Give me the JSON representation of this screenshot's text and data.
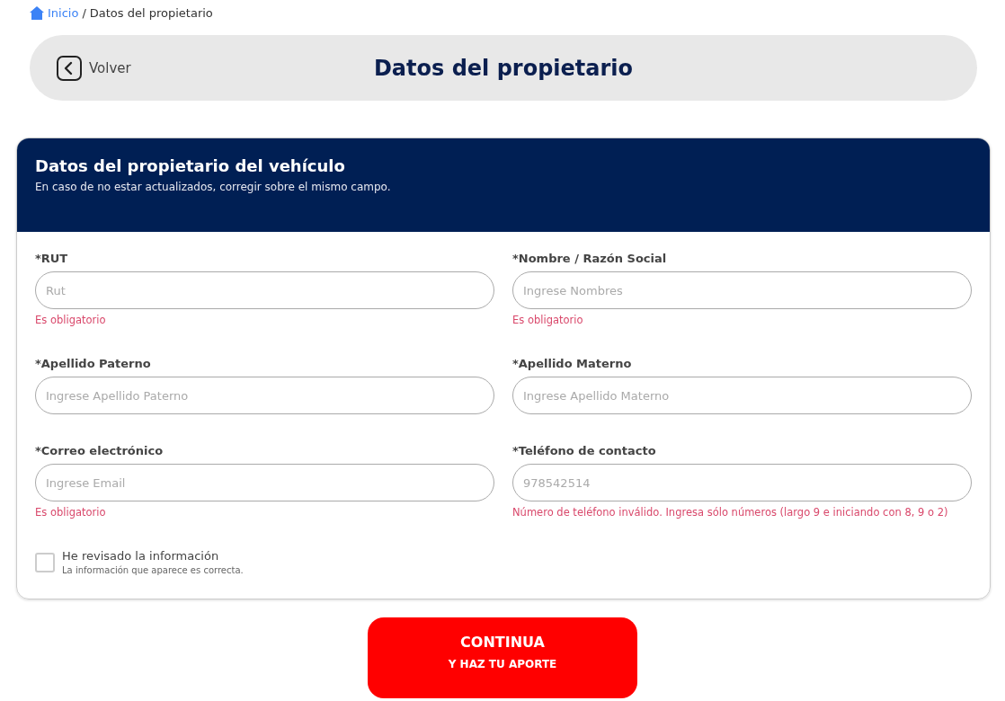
{
  "breadcrumb": {
    "home": "Inicio",
    "separator": "/",
    "current": "Datos del propietario"
  },
  "header": {
    "back": "Volver",
    "title": "Datos del propietario"
  },
  "card": {
    "title": "Datos del propietario del vehículo",
    "subtitle": "En caso de no estar actualizados, corregir sobre el mismo campo.",
    "fields": [
      {
        "label": "*RUT",
        "placeholder": "Rut",
        "error": "Es obligatorio"
      },
      {
        "label": "*Nombre / Razón Social",
        "placeholder": "Ingrese Nombres",
        "error": "Es obligatorio"
      },
      {
        "label": "*Apellido Paterno",
        "placeholder": "Ingrese Apellido Paterno"
      },
      {
        "label": "*Apellido Materno",
        "placeholder": "Ingrese Apellido Materno"
      },
      {
        "label": "*Correo electrónico",
        "placeholder": "Ingrese Email",
        "error": "Es obligatorio"
      },
      {
        "label": "*Teléfono de contacto",
        "placeholder": "978542514",
        "error": "Número de teléfono inválido. Ingresa sólo números (largo 9 e iniciando con 8, 9 o 2)"
      }
    ],
    "confirm": {
      "label": "He revisado la información",
      "hint": "La información que aparece es correcta.",
      "checked": false
    }
  },
  "button": {
    "line_1": "CONTINUA",
    "line_2": "Y HAZ TU APORTE"
  }
}
